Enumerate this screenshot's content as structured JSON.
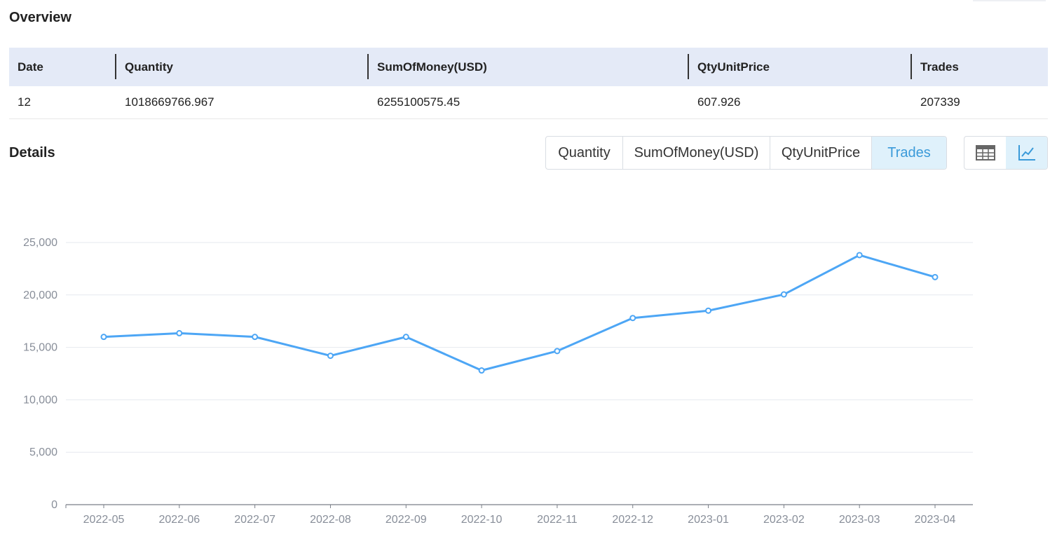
{
  "overview": {
    "title": "Overview",
    "columns": [
      "Date",
      "Quantity",
      "SumOfMoney(USD)",
      "QtyUnitPrice",
      "Trades"
    ],
    "row": [
      "12",
      "1018669766.967",
      "6255100575.45",
      "607.926",
      "207339"
    ]
  },
  "details": {
    "title": "Details",
    "tabs": [
      "Quantity",
      "SumOfMoney(USD)",
      "QtyUnitPrice",
      "Trades"
    ],
    "active_tab": "Trades",
    "view_buttons": [
      {
        "icon": "table-icon",
        "active": false
      },
      {
        "icon": "line-chart-icon",
        "active": true
      }
    ]
  },
  "colors": {
    "accent": "#4da6f5",
    "active_tab_bg": "#dff1fb",
    "active_tab_text": "#3a9ad9",
    "header_bg": "#e4eaf7",
    "grid": "#e6e9ef",
    "axis_text": "#888e99"
  },
  "chart_data": {
    "type": "line",
    "categories": [
      "2022-05",
      "2022-06",
      "2022-07",
      "2022-08",
      "2022-09",
      "2022-10",
      "2022-11",
      "2022-12",
      "2023-01",
      "2023-02",
      "2023-03",
      "2023-04"
    ],
    "series": [
      {
        "values": [
          16000,
          16350,
          16000,
          14200,
          16000,
          12800,
          14650,
          17800,
          18500,
          20050,
          23800,
          21700
        ]
      }
    ],
    "ylim": [
      0,
      25000
    ],
    "yticks": [
      0,
      5000,
      10000,
      15000,
      20000,
      25000
    ],
    "ytick_labels": [
      "0",
      "5,000",
      "10,000",
      "15,000",
      "20,000",
      "25,000"
    ],
    "grid": true,
    "legend": "none"
  }
}
